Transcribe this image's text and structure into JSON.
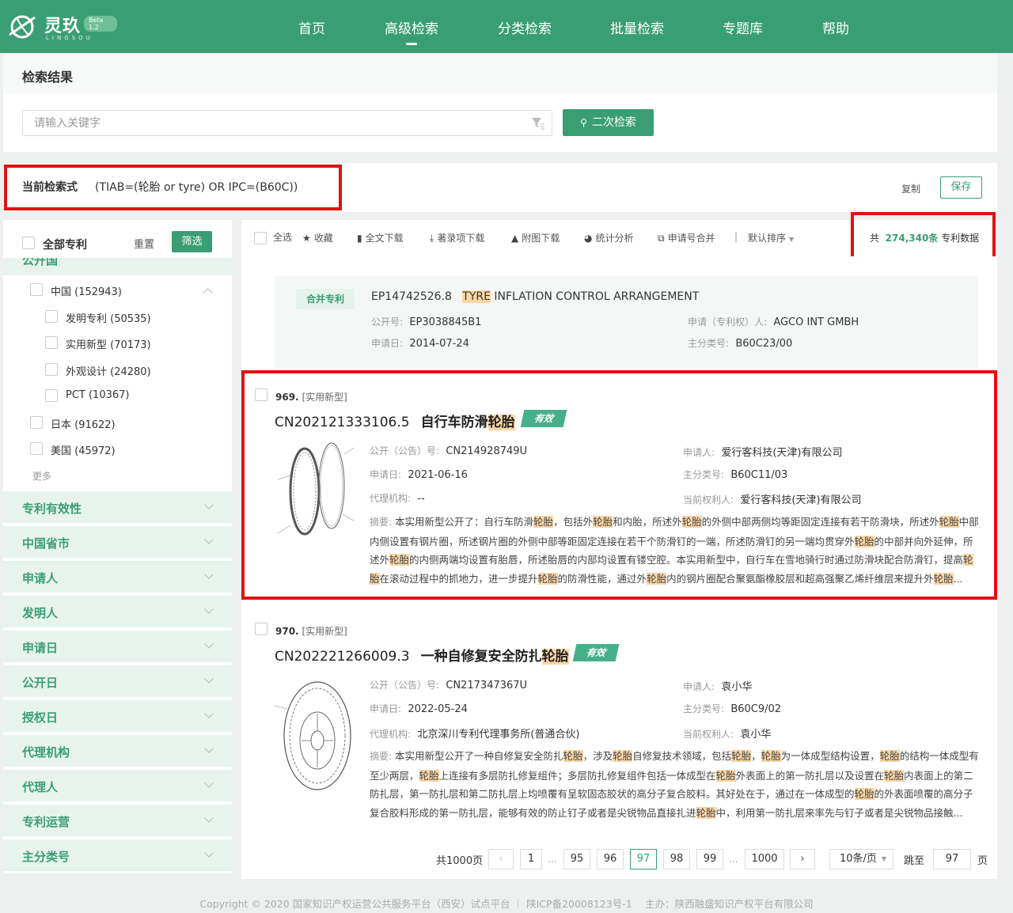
{
  "brand": {
    "name": "灵玖",
    "sub": "LINGSOU",
    "beta": "Beta 1.2"
  },
  "nav": [
    {
      "label": "首页",
      "active": false
    },
    {
      "label": "高级检索",
      "active": true
    },
    {
      "label": "分类检索",
      "active": false
    },
    {
      "label": "批量检索",
      "active": false
    },
    {
      "label": "专题库",
      "active": false
    },
    {
      "label": "帮助",
      "active": false
    }
  ],
  "search": {
    "title": "检索结果",
    "placeholder": "请输入关键字",
    "button": "二次检索"
  },
  "query": {
    "label": "当前检索式",
    "expression": "(TIAB=(轮胎 or tyre) OR IPC=(B60C))",
    "copy": "复制",
    "save": "保存"
  },
  "sidebar": {
    "all_label": "全部专利",
    "reset": "重置",
    "filter": "筛选",
    "section_cut": "公开国",
    "countries": [
      {
        "label": "中国 (152943)",
        "level": 1
      },
      {
        "label": "发明专利 (50535)",
        "level": 2
      },
      {
        "label": "实用新型 (70173)",
        "level": 2
      },
      {
        "label": "外观设计 (24280)",
        "level": 2
      },
      {
        "label": "PCT (10367)",
        "level": 2
      },
      {
        "label": "日本 (91622)",
        "level": 1
      },
      {
        "label": "美国 (45972)",
        "level": 1
      }
    ],
    "more": "更多",
    "facets": [
      "专利有效性",
      "中国省市",
      "申请人",
      "发明人",
      "申请日",
      "公开日",
      "授权日",
      "代理机构",
      "代理人",
      "专利运营",
      "主分类号"
    ]
  },
  "toolbar": {
    "select_all": "全选",
    "favorite": "收藏",
    "fulltext": "全文下载",
    "biblio": "著录项下载",
    "drawings": "附图下载",
    "stats": "统计分析",
    "merge": "申请号合并",
    "sort": "默认排序",
    "total_prefix": "共",
    "total_count": "274,340条",
    "total_suffix": "专利数据"
  },
  "merged_record": {
    "tag": "合并专利",
    "number": "EP14742526.8",
    "title_hl": "TYRE",
    "title_rest": " INFLATION CONTROL ARRANGEMENT",
    "pub_label": "公开号:",
    "pub_no": "EP3038845B1",
    "app_label": "申请（专利权）人:",
    "applicant": "AGCO INT GMBH",
    "date_label": "申请日:",
    "date": "2014-07-24",
    "ipc_label": "主分类号:",
    "ipc": "B60C23/00"
  },
  "records": [
    {
      "index": "969.",
      "type": "[实用新型]",
      "number": "CN202121333106.5",
      "title_pre": "自行车防滑",
      "title_hl": "轮胎",
      "status": "有效",
      "pub_label": "公开（公告）号:",
      "pub_no": "CN214928749U",
      "applicant_label": "申请人:",
      "applicant": "爱行客科技(天津)有限公司",
      "date_label": "申请日:",
      "date": "2021-06-16",
      "ipc_label": "主分类号:",
      "ipc": "B60C11/03",
      "agency_label": "代理机构:",
      "agency": "--",
      "owner_label": "当前权利人:",
      "owner": "爱行客科技(天津)有限公司",
      "abstract_label": "摘要:",
      "abstract": "本实用新型公开了：自行车防滑轮胎，包括外轮胎和内胎，所述外轮胎的外侧中部两侧均等距固定连接有若干防滑块，所述外轮胎中部内侧设置有钢片圈，所述钢片圈的外侧中部等距固定连接在若干个防滑钉的一端，所述防滑钉的另一端均贯穿外轮胎的中部并向外延伸，所述外轮胎的内侧两端均设置有胎唇，所述胎唇的内部均设置有镂空腔。本实用新型中，自行车在雪地骑行时通过防滑块配合防滑钉，提高轮胎在滚动过程中的抓地力，进一步提升轮胎的防滑性能，通过外轮胎内的钢片圈配合聚氨酯橡胶层和超高强聚乙烯纤维层来提升外轮胎..."
    },
    {
      "index": "970.",
      "type": "[实用新型]",
      "number": "CN202221266009.3",
      "title_pre": "一种自修复安全防扎",
      "title_hl": "轮胎",
      "status": "有效",
      "pub_label": "公开（公告）号:",
      "pub_no": "CN217347367U",
      "applicant_label": "申请人:",
      "applicant": "袁小华",
      "date_label": "申请日:",
      "date": "2022-05-24",
      "ipc_label": "主分类号:",
      "ipc": "B60C9/02",
      "agency_label": "代理机构:",
      "agency": "北京深川专利代理事务所(普通合伙)",
      "owner_label": "当前权利人:",
      "owner": "袁小华",
      "abstract_label": "摘要:",
      "abstract": "本实用新型公开了一种自修复安全防扎轮胎，涉及轮胎自修复技术领域，包括轮胎，轮胎为一体成型结构设置，轮胎的结构一体成型有至少两层，轮胎上连接有多层防扎修复组件；多层防扎修复组件包括一体成型在轮胎外表面上的第一防扎层以及设置在轮胎内表面上的第二防扎层，第一防扎层和第二防扎层上均喷覆有呈软固态胶状的高分子复合胶料。其好处在于，通过在一体成型的轮胎的外表面喷覆的高分子复合胶料形成的第一防扎层，能够有效的防止钉子或者是尖锐物品直接扎进轮胎中，利用第一防扎层来率先与钉子或者是尖锐物品接触..."
    }
  ],
  "pagination": {
    "total": "共1000页",
    "pages": [
      "1",
      "...",
      "95",
      "96",
      "97",
      "98",
      "99",
      "...",
      "1000"
    ],
    "current": "97",
    "per_page": "10条/页",
    "jump_label": "跳至",
    "jump_value": "97",
    "page_suffix": "页"
  },
  "footer": "Copyright © 2020 国家知识产权运营公共服务平台（西安）试点平台 ｜ 陕ICP备20008123号-1　 主办：陕西融盛知识产权平台有限公司",
  "colors": {
    "brand": "#3a9e74",
    "highlight": "#fbd6a5",
    "annotation": "#e31010"
  }
}
